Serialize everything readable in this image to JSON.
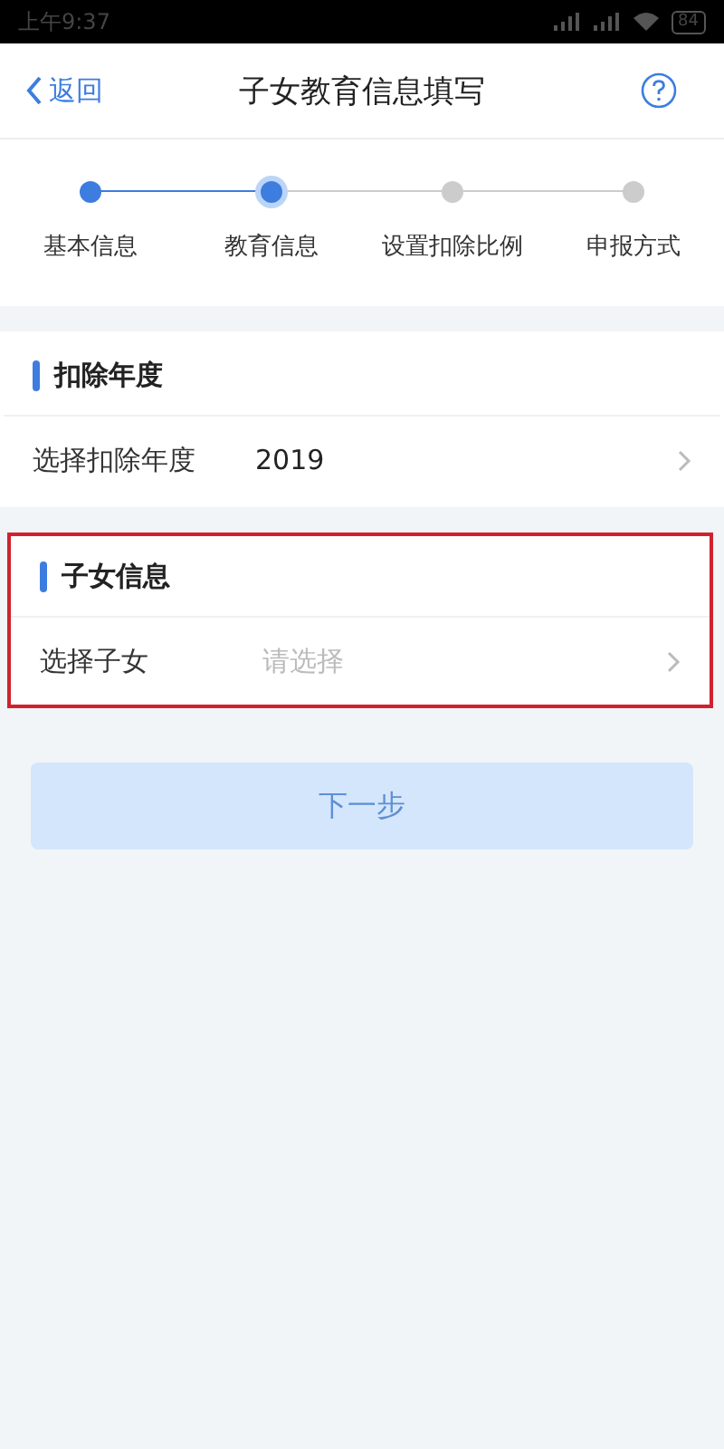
{
  "status_bar": {
    "time": "上午9:37",
    "battery": "84"
  },
  "nav": {
    "back": "返回",
    "title": "子女教育信息填写"
  },
  "steps": [
    {
      "label": "基本信息",
      "kind": "done"
    },
    {
      "label": "教育信息",
      "kind": "current"
    },
    {
      "label": "设置扣除比例",
      "kind": "pending"
    },
    {
      "label": "申报方式",
      "kind": "pending"
    }
  ],
  "sections": [
    {
      "title": "扣除年度",
      "highlighted": false,
      "row": {
        "label": "选择扣除年度",
        "value": "2019"
      }
    },
    {
      "title": "子女信息",
      "highlighted": true,
      "row": {
        "label": "选择子女",
        "placeholder": "请选择"
      }
    }
  ],
  "next_button": {
    "label": "下一步",
    "disabled": true
  }
}
